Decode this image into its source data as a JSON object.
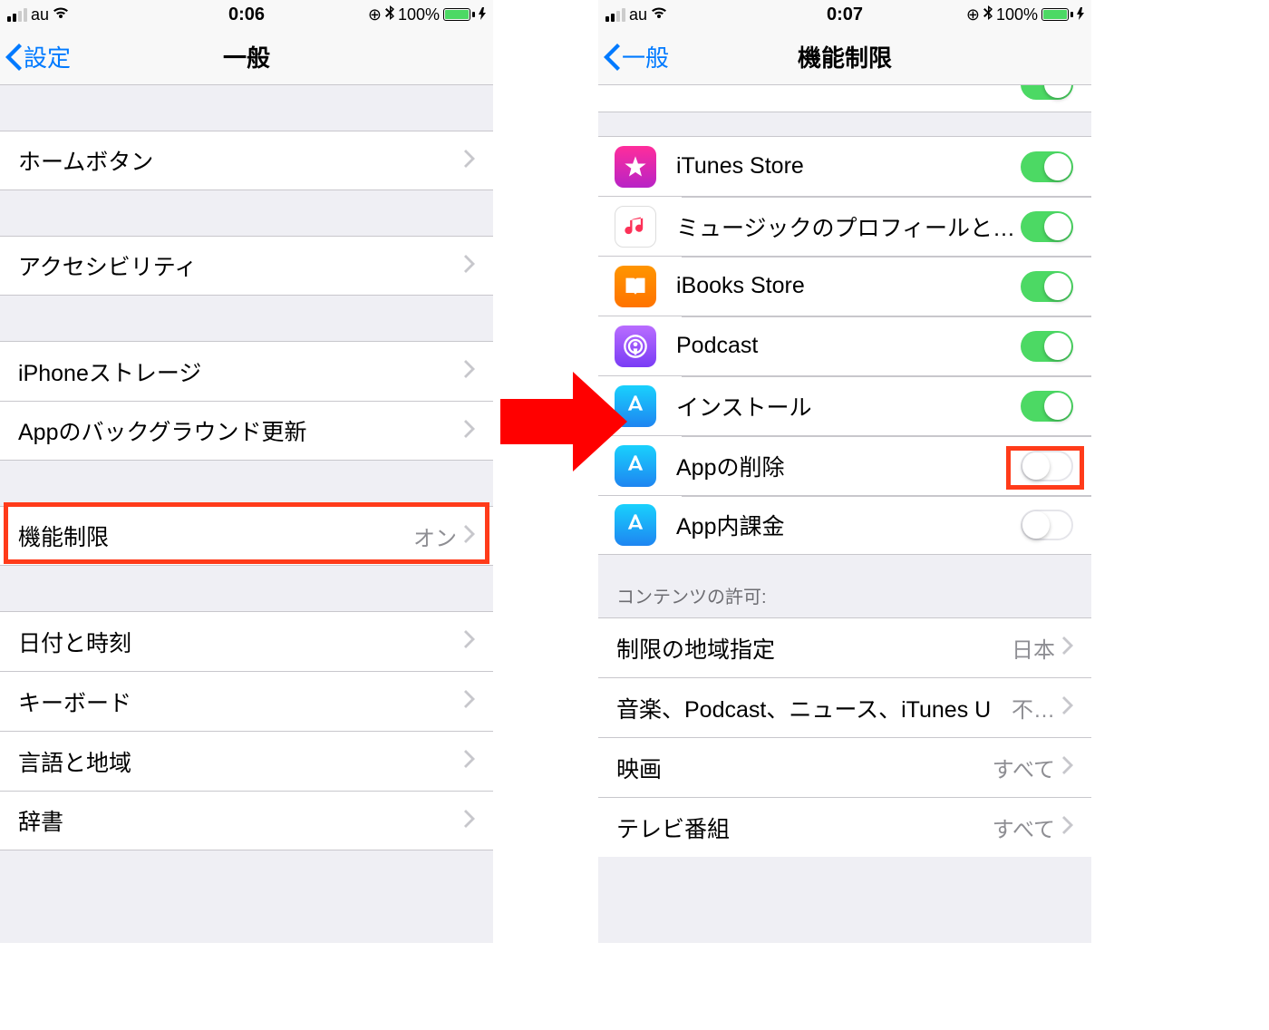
{
  "left": {
    "status": {
      "carrier": "au",
      "time": "0:06",
      "battery": "100%"
    },
    "nav": {
      "back": "設定",
      "title": "一般"
    },
    "rows": {
      "home_button": "ホームボタン",
      "accessibility": "アクセシビリティ",
      "storage": "iPhoneストレージ",
      "bg_refresh": "Appのバックグラウンド更新",
      "restrictions": {
        "label": "機能制限",
        "value": "オン"
      },
      "datetime": "日付と時刻",
      "keyboard": "キーボード",
      "lang_region": "言語と地域",
      "dictionary": "辞書"
    }
  },
  "right": {
    "status": {
      "carrier": "au",
      "time": "0:07",
      "battery": "100%"
    },
    "nav": {
      "back": "一般",
      "title": "機能制限"
    },
    "toggles": {
      "itunes": {
        "label": "iTunes Store",
        "on": true
      },
      "music": {
        "label": "ミュージックのプロフィールと…",
        "on": true
      },
      "ibooks": {
        "label": "iBooks Store",
        "on": true
      },
      "podcast": {
        "label": "Podcast",
        "on": true
      },
      "install": {
        "label": "インストール",
        "on": true
      },
      "delete": {
        "label": "Appの削除",
        "on": false
      },
      "iap": {
        "label": "App内課金",
        "on": false
      }
    },
    "section_header": "コンテンツの許可:",
    "content_rows": {
      "region": {
        "label": "制限の地域指定",
        "value": "日本"
      },
      "music_pod": {
        "label": "音楽、Podcast、ニュース、iTunes U",
        "value": "不…"
      },
      "movies": {
        "label": "映画",
        "value": "すべて"
      },
      "tv": {
        "label": "テレビ番組",
        "value": "すべて"
      }
    }
  }
}
